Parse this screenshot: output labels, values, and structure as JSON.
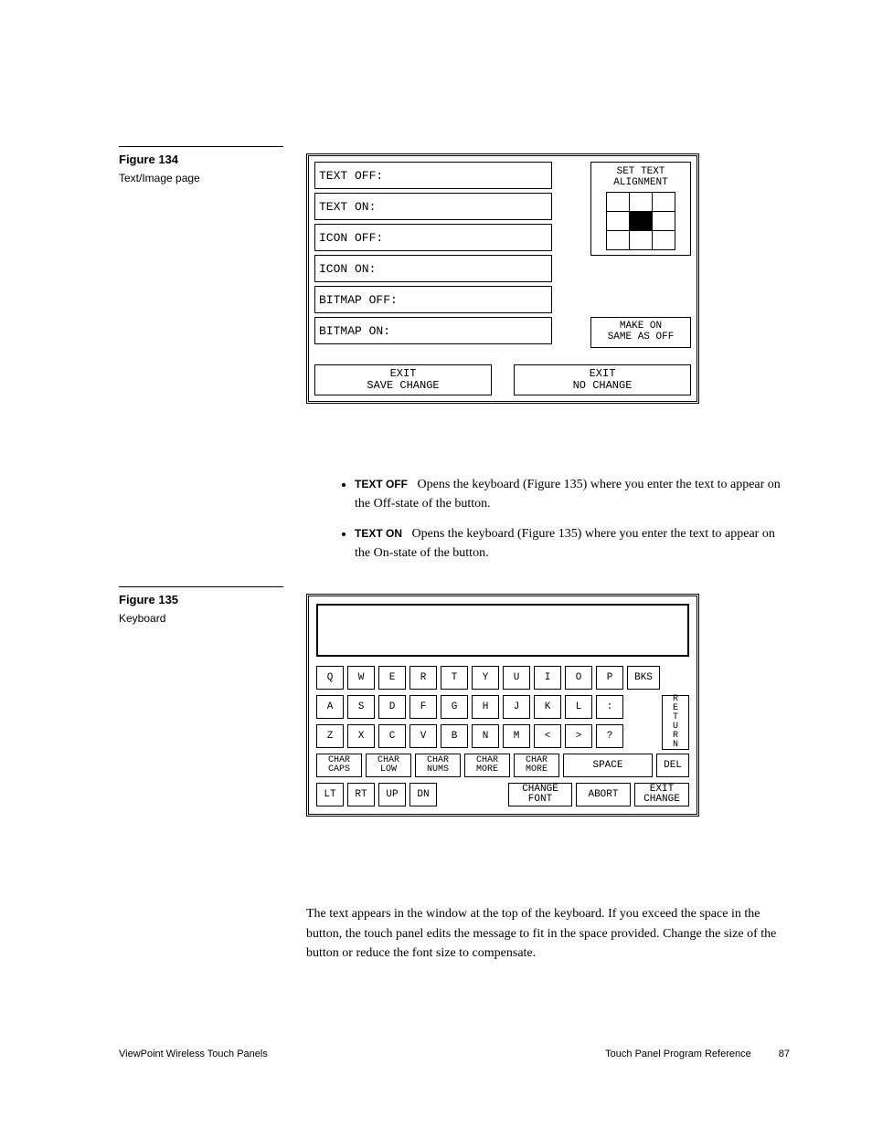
{
  "fig134": {
    "label": "Figure 134",
    "caption": "Text/Image page",
    "fields": [
      "TEXT OFF:",
      "TEXT ON:",
      "ICON OFF:",
      "ICON ON:",
      "BITMAP OFF:",
      "BITMAP ON:"
    ],
    "set_text_alignment": "SET TEXT\nALIGNMENT",
    "make_on": "MAKE ON\nSAME AS OFF",
    "exit_save": "EXIT\nSAVE CHANGE",
    "exit_no": "EXIT\nNO CHANGE"
  },
  "bullets": [
    {
      "bold": "TEXT OFF",
      "text": "Opens the keyboard (Figure 135) where you enter the text to appear on the Off-state of the button."
    },
    {
      "bold": "TEXT ON",
      "text": "Opens the keyboard (Figure 135) where you enter the text to appear on the On-state of the button."
    }
  ],
  "fig135": {
    "label": "Figure 135",
    "caption": "Keyboard",
    "row1": [
      "Q",
      "W",
      "E",
      "R",
      "T",
      "Y",
      "U",
      "I",
      "O",
      "P",
      "BKS"
    ],
    "row2": [
      "A",
      "S",
      "D",
      "F",
      "G",
      "H",
      "J",
      "K",
      "L",
      ":"
    ],
    "row3": [
      "Z",
      "X",
      "C",
      "V",
      "B",
      "N",
      "M",
      "<",
      ">",
      "?"
    ],
    "return": "RETURN",
    "row4": [
      "CHAR\nCAPS",
      "CHAR\nLOW",
      "CHAR\nNUMS",
      "CHAR\nMORE",
      "CHAR\nMORE",
      "SPACE",
      "DEL"
    ],
    "row5": [
      "LT",
      "RT",
      "UP",
      "DN",
      "CHANGE\nFONT",
      "ABORT",
      "EXIT\nCHANGE"
    ]
  },
  "para": "The text appears in the window at the top of the keyboard. If you exceed the space in the button, the touch panel edits the message to fit in the space provided. Change the size of the button or reduce the font size to compensate.",
  "footer": {
    "left": "ViewPoint Wireless Touch Panels",
    "right_section": "Touch Panel Program Reference",
    "page": "87"
  }
}
